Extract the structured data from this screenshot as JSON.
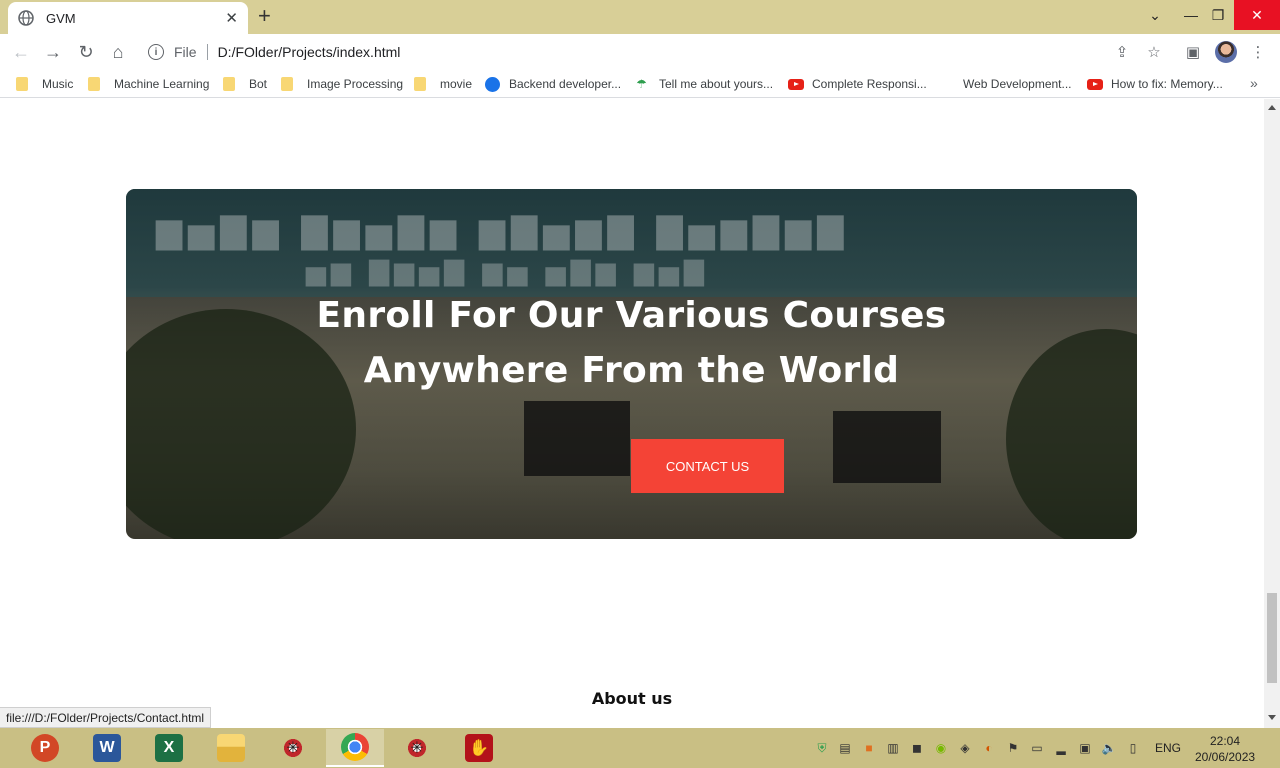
{
  "browser": {
    "tab_title": "GVM",
    "address_scheme": "File",
    "address_url": "D:/FOlder/Projects/index.html",
    "new_tab_symbol": "+",
    "status_link": "file:///D:/FOlder/Projects/Contact.html"
  },
  "bookmarks": [
    {
      "label": "Music",
      "icon": "folder-icon"
    },
    {
      "label": "Machine Learning",
      "icon": "folder-icon"
    },
    {
      "label": "Bot",
      "icon": "folder-icon"
    },
    {
      "label": "Image Processing",
      "icon": "folder-icon"
    },
    {
      "label": "movie",
      "icon": "folder-icon"
    },
    {
      "label": "Backend developer...",
      "icon": "arc-icon"
    },
    {
      "label": "Tell me about yours...",
      "icon": "umbrella-icon"
    },
    {
      "label": "Complete Responsi...",
      "icon": "youtube-icon"
    },
    {
      "label": "Web Development...",
      "icon": "none"
    },
    {
      "label": "How to fix: Memory...",
      "icon": "youtube-icon"
    }
  ],
  "page": {
    "hero_line1": "Enroll For Our Various Courses",
    "hero_line2": "Anywhere From the World",
    "cta_label": "CONTACT US",
    "about_heading": "About us"
  },
  "taskbar": {
    "language": "ENG",
    "time": "22:04",
    "date": "20/06/2023",
    "apps": [
      "powerpoint",
      "word",
      "excel",
      "file-explorer",
      "web-app",
      "chrome",
      "web-app-2",
      "pdf-reader"
    ]
  },
  "colors": {
    "title_bar": "#d8cf97",
    "taskbar": "#c9bf84",
    "cta_button": "#f44336",
    "close_button": "#e81123"
  }
}
